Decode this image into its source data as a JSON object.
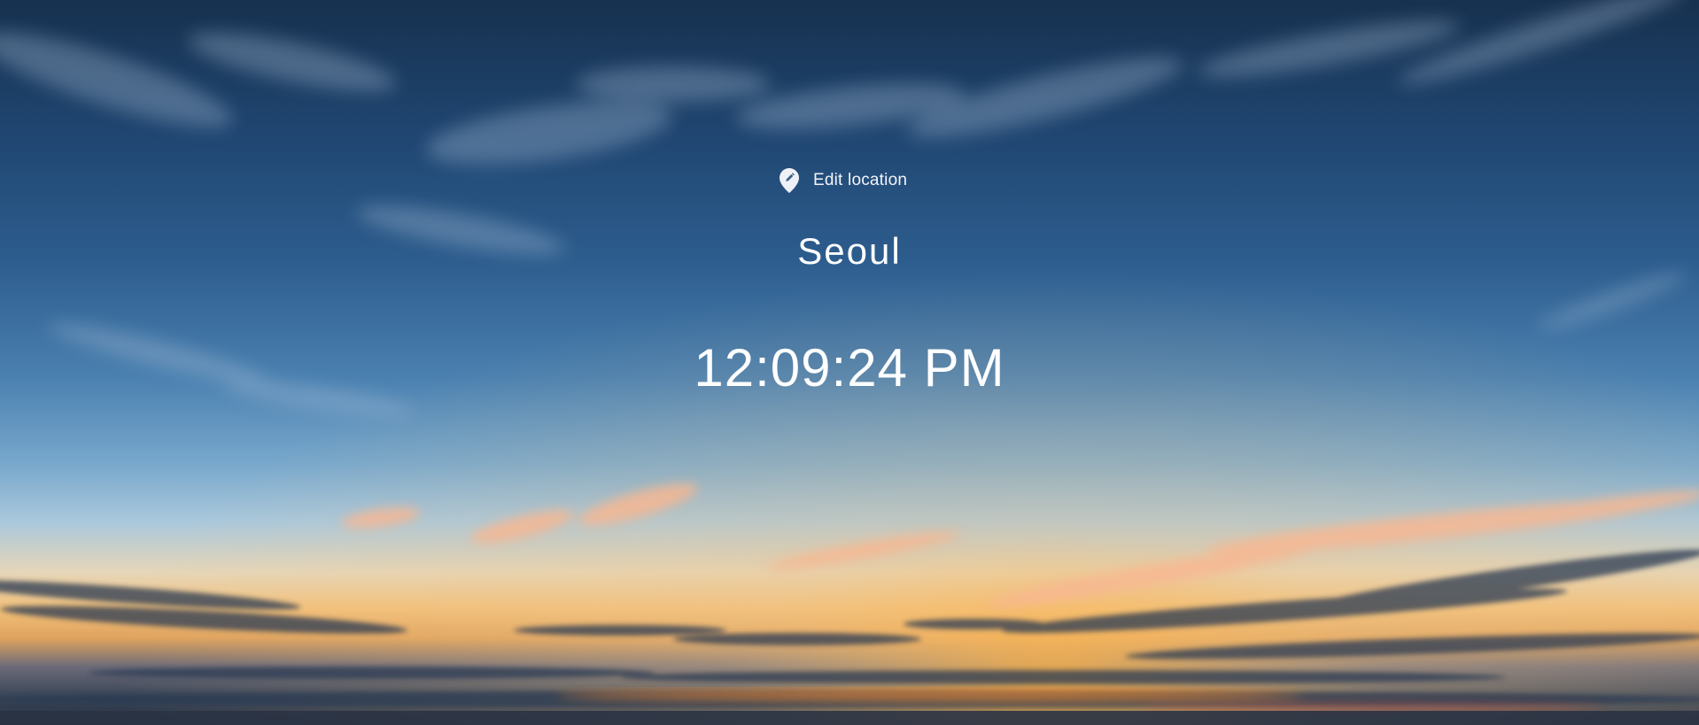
{
  "location_button": {
    "label": "Edit location",
    "icon": "location-pin-edit-icon"
  },
  "city": {
    "name": "Seoul"
  },
  "clock": {
    "time": "12:09:24 PM"
  },
  "colors": {
    "text": "#ffffff",
    "sky_top": "#17314f",
    "sky_mid": "#4a80b0",
    "horizon_glow": "#f2c07a",
    "ground": "#273142"
  }
}
